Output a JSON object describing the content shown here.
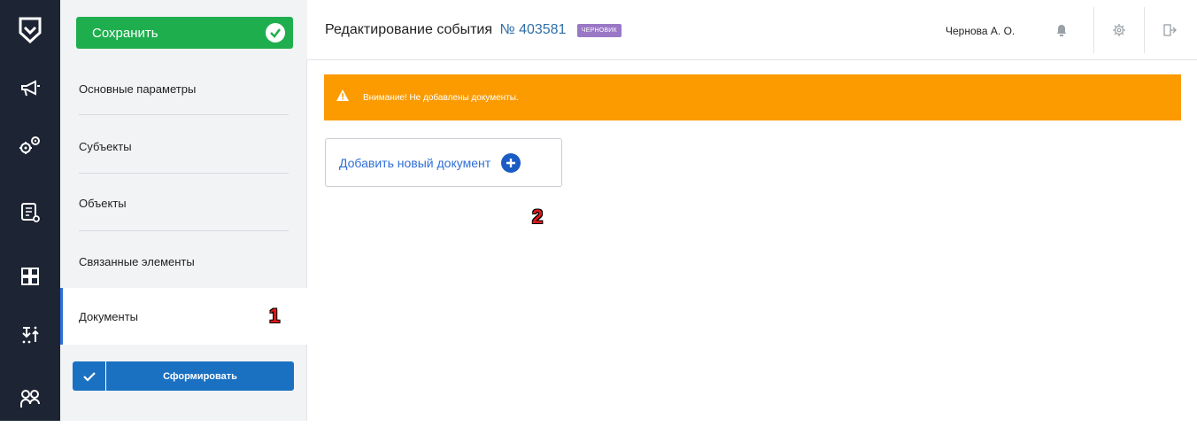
{
  "header": {
    "title": "Редактирование события",
    "event_number": "№ 403581",
    "status_badge": "ЧЕРНОВИК",
    "user_name": "Чернова А. О."
  },
  "nav": {
    "save_label": "Сохранить",
    "items": [
      {
        "label": "Основные параметры"
      },
      {
        "label": "Субъекты"
      },
      {
        "label": "Объекты"
      },
      {
        "label": "Связанные элементы"
      },
      {
        "label": "Документы",
        "active": true
      }
    ],
    "form_button_label": "Сформировать"
  },
  "rail": {
    "icons": [
      "logo-icon",
      "megaphone-icon",
      "gears-icon",
      "document-list-icon",
      "dashboard-grid-icon",
      "sort-arrows-icon",
      "users-icon"
    ]
  },
  "main": {
    "alert_text": "Внимание! Не добавлены документы.",
    "add_document_label": "Добавить новый документ"
  },
  "annotations": {
    "marker_1": "1",
    "marker_2": "2"
  },
  "colors": {
    "save_green": "#1fae4e",
    "alert_orange": "#fb9b00",
    "primary_blue": "#1a71c2",
    "rail_dark": "#1d2433",
    "badge_purple": "#9a78c6"
  }
}
